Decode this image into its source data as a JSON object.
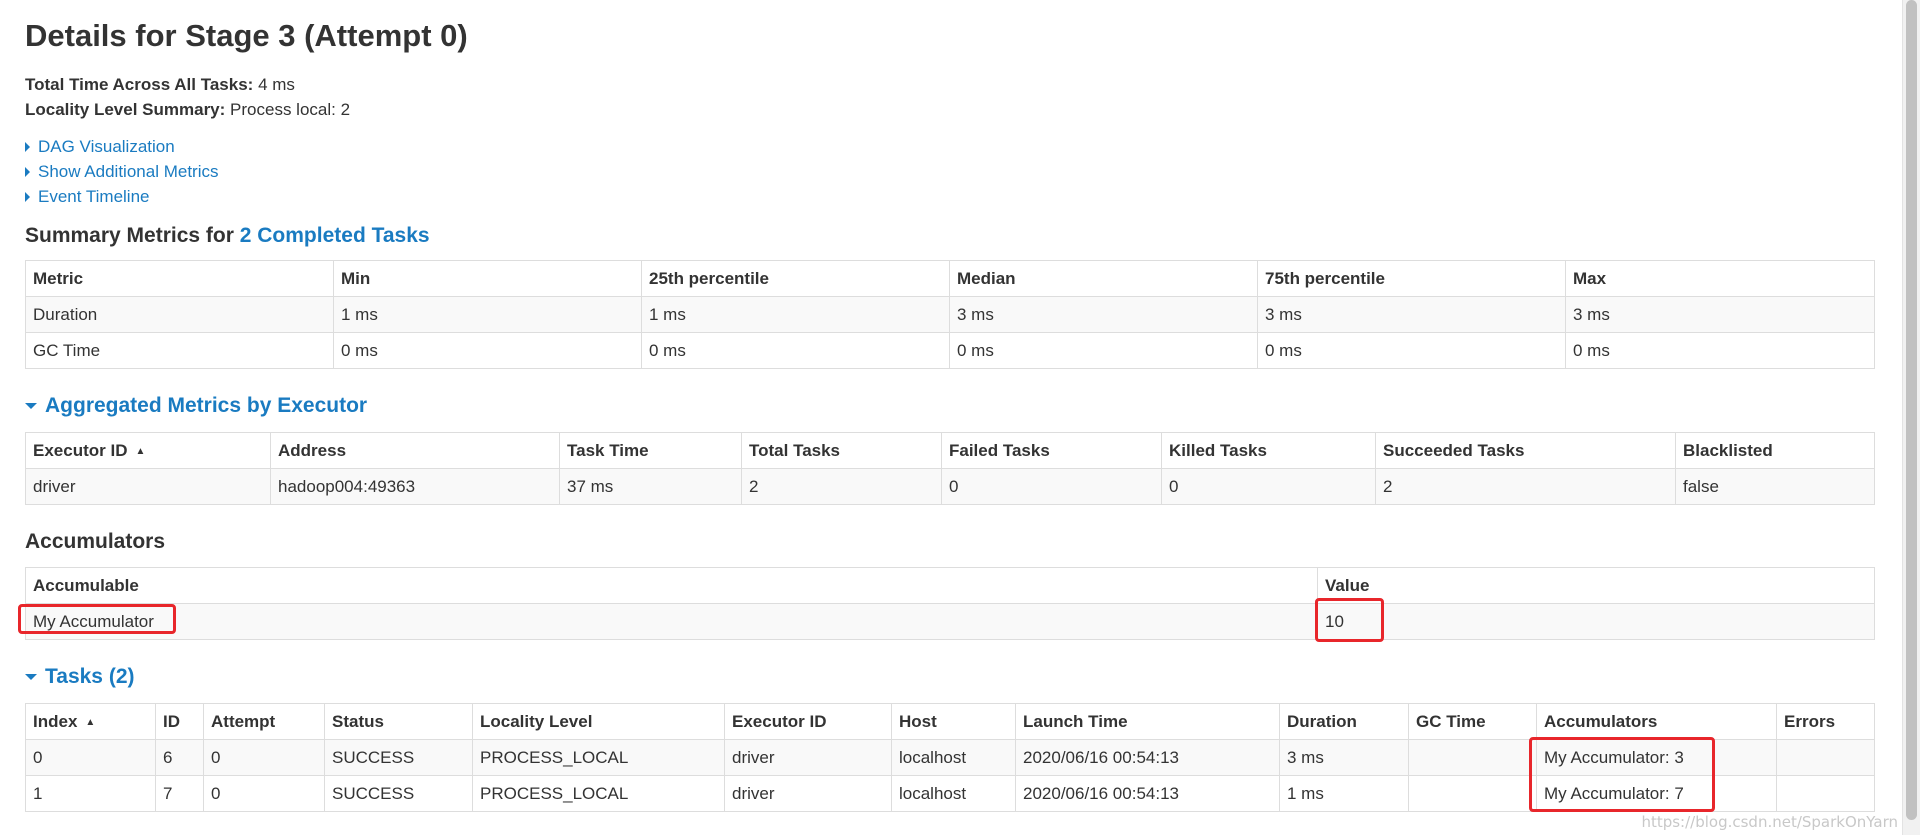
{
  "page": {
    "title": "Details for Stage 3 (Attempt 0)"
  },
  "summary": {
    "total_time_label": "Total Time Across All Tasks:",
    "total_time_value": "4 ms",
    "locality_label": "Locality Level Summary:",
    "locality_value": "Process local: 2"
  },
  "links": {
    "dag": "DAG Visualization",
    "additional_metrics": "Show Additional Metrics",
    "event_timeline": "Event Timeline"
  },
  "summary_metrics": {
    "heading_prefix": "Summary Metrics for",
    "heading_link": "2 Completed Tasks",
    "columns": [
      "Metric",
      "Min",
      "25th percentile",
      "Median",
      "75th percentile",
      "Max"
    ],
    "rows": [
      [
        "Duration",
        "1 ms",
        "1 ms",
        "3 ms",
        "3 ms",
        "3 ms"
      ],
      [
        "GC Time",
        "0 ms",
        "0 ms",
        "0 ms",
        "0 ms",
        "0 ms"
      ]
    ]
  },
  "aggregated": {
    "heading": "Aggregated Metrics by Executor",
    "columns": [
      "Executor ID",
      "Address",
      "Task Time",
      "Total Tasks",
      "Failed Tasks",
      "Killed Tasks",
      "Succeeded Tasks",
      "Blacklisted"
    ],
    "sort_indicator": "▲",
    "rows": [
      [
        "driver",
        "hadoop004:49363",
        "37 ms",
        "2",
        "0",
        "0",
        "2",
        "false"
      ]
    ]
  },
  "accumulators": {
    "heading": "Accumulators",
    "columns": [
      "Accumulable",
      "Value"
    ],
    "rows": [
      [
        "My Accumulator",
        "10"
      ]
    ]
  },
  "tasks": {
    "heading": "Tasks (2)",
    "sort_indicator": "▲",
    "columns": [
      "Index",
      "ID",
      "Attempt",
      "Status",
      "Locality Level",
      "Executor ID",
      "Host",
      "Launch Time",
      "Duration",
      "GC Time",
      "Accumulators",
      "Errors"
    ],
    "rows": [
      [
        "0",
        "6",
        "0",
        "SUCCESS",
        "PROCESS_LOCAL",
        "driver",
        "localhost",
        "2020/06/16 00:54:13",
        "3 ms",
        "",
        "My Accumulator: 3",
        ""
      ],
      [
        "1",
        "7",
        "0",
        "SUCCESS",
        "PROCESS_LOCAL",
        "driver",
        "localhost",
        "2020/06/16 00:54:13",
        "1 ms",
        "",
        "My Accumulator: 7",
        ""
      ]
    ]
  },
  "watermark": "https://blog.csdn.net/SparkOnYarn",
  "colors": {
    "link": "#1a7bc1",
    "highlight": "#e8262b",
    "border": "#dddddd",
    "stripe": "#f9f9f9"
  }
}
